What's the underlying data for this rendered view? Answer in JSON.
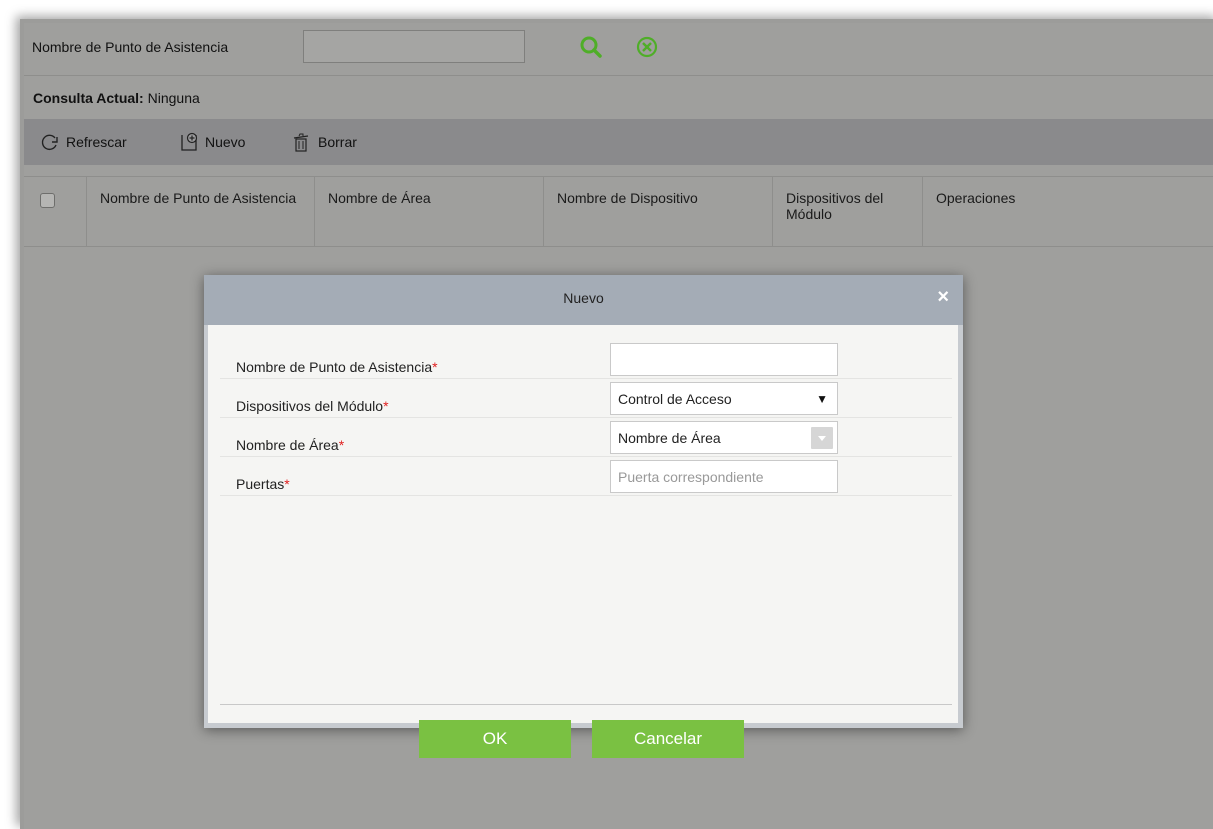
{
  "search": {
    "label": "Nombre de Punto de Asistencia",
    "value": "",
    "search_icon": "search-icon",
    "clear_icon": "clear-circle-x-icon"
  },
  "query": {
    "label": "Consulta Actual:",
    "value": "Ninguna"
  },
  "toolbar": {
    "refresh_label": "Refrescar",
    "new_label": "Nuevo",
    "delete_label": "Borrar"
  },
  "table": {
    "columns": [
      "Nombre de Punto de Asistencia",
      "Nombre de Área",
      "Nombre de Dispositivo",
      "Dispositivos del Módulo",
      "Operaciones"
    ]
  },
  "dialog": {
    "title": "Nuevo",
    "close_symbol": "×",
    "required_mark": "*",
    "fields": [
      {
        "label": "Nombre de Punto de Asistencia",
        "value": "",
        "placeholder": ""
      },
      {
        "label": "Dispositivos del Módulo",
        "value": "Control de Acceso",
        "arrow": "▼"
      },
      {
        "label": "Nombre de Área",
        "value": "Nombre de Área"
      },
      {
        "label": "Puertas",
        "value": "",
        "placeholder": "Puerta correspondiente"
      }
    ],
    "ok_label": "OK",
    "cancel_label": "Cancelar"
  },
  "colors": {
    "accent_green": "#7ac142",
    "required_red": "#e02020",
    "icon_green": "#4fae28"
  }
}
